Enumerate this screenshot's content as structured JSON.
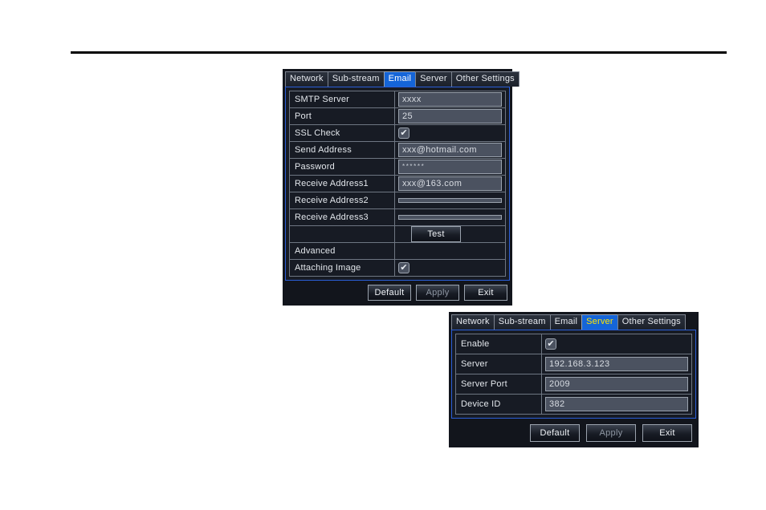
{
  "page": {
    "rule": "horizontal-rule"
  },
  "email_dialog": {
    "tabs": [
      {
        "label": "Network",
        "active": false
      },
      {
        "label": "Sub-stream",
        "active": false
      },
      {
        "label": "Email",
        "active": true
      },
      {
        "label": "Server",
        "active": false
      },
      {
        "label": "Other Settings",
        "active": false
      }
    ],
    "rows": [
      {
        "label": "SMTP Server",
        "type": "text",
        "value": "xxxx"
      },
      {
        "label": "Port",
        "type": "text",
        "value": "25"
      },
      {
        "label": "SSL Check",
        "type": "checkbox",
        "checked": true
      },
      {
        "label": "Send Address",
        "type": "text",
        "value": "xxx@hotmail.com"
      },
      {
        "label": "Password",
        "type": "password",
        "value": "******"
      },
      {
        "label": "Receive Address1",
        "type": "text",
        "value": "xxx@163.com"
      },
      {
        "label": "Receive Address2",
        "type": "text",
        "value": ""
      },
      {
        "label": "Receive Address3",
        "type": "text",
        "value": ""
      },
      {
        "label": "",
        "type": "button",
        "value": "Test"
      },
      {
        "label": "Advanced",
        "type": "none",
        "value": ""
      },
      {
        "label": "Attaching Image",
        "type": "checkbox",
        "checked": true
      }
    ],
    "buttons": {
      "default": "Default",
      "apply": "Apply",
      "exit": "Exit"
    }
  },
  "server_dialog": {
    "tabs": [
      {
        "label": "Network",
        "active": false
      },
      {
        "label": "Sub-stream",
        "active": false
      },
      {
        "label": "Email",
        "active": false
      },
      {
        "label": "Server",
        "active": true
      },
      {
        "label": "Other Settings",
        "active": false
      }
    ],
    "rows": [
      {
        "label": "Enable",
        "type": "checkbox",
        "checked": true
      },
      {
        "label": "Server",
        "type": "text",
        "value": "192.168.3.123"
      },
      {
        "label": "Server Port",
        "type": "text",
        "value": "2009"
      },
      {
        "label": "Device ID",
        "type": "text",
        "value": "382"
      }
    ],
    "buttons": {
      "default": "Default",
      "apply": "Apply",
      "exit": "Exit"
    }
  },
  "colors": {
    "dialog_bg": "#12151c",
    "panel_border": "#2b5fd9",
    "active_tab_bg": "#1565d8",
    "active_tab_text": "#ffffff",
    "server_tab_text": "#ffe500",
    "field_bg": "#4b5260",
    "grid_line": "#6e7682"
  },
  "icons": {
    "check": "✔"
  }
}
